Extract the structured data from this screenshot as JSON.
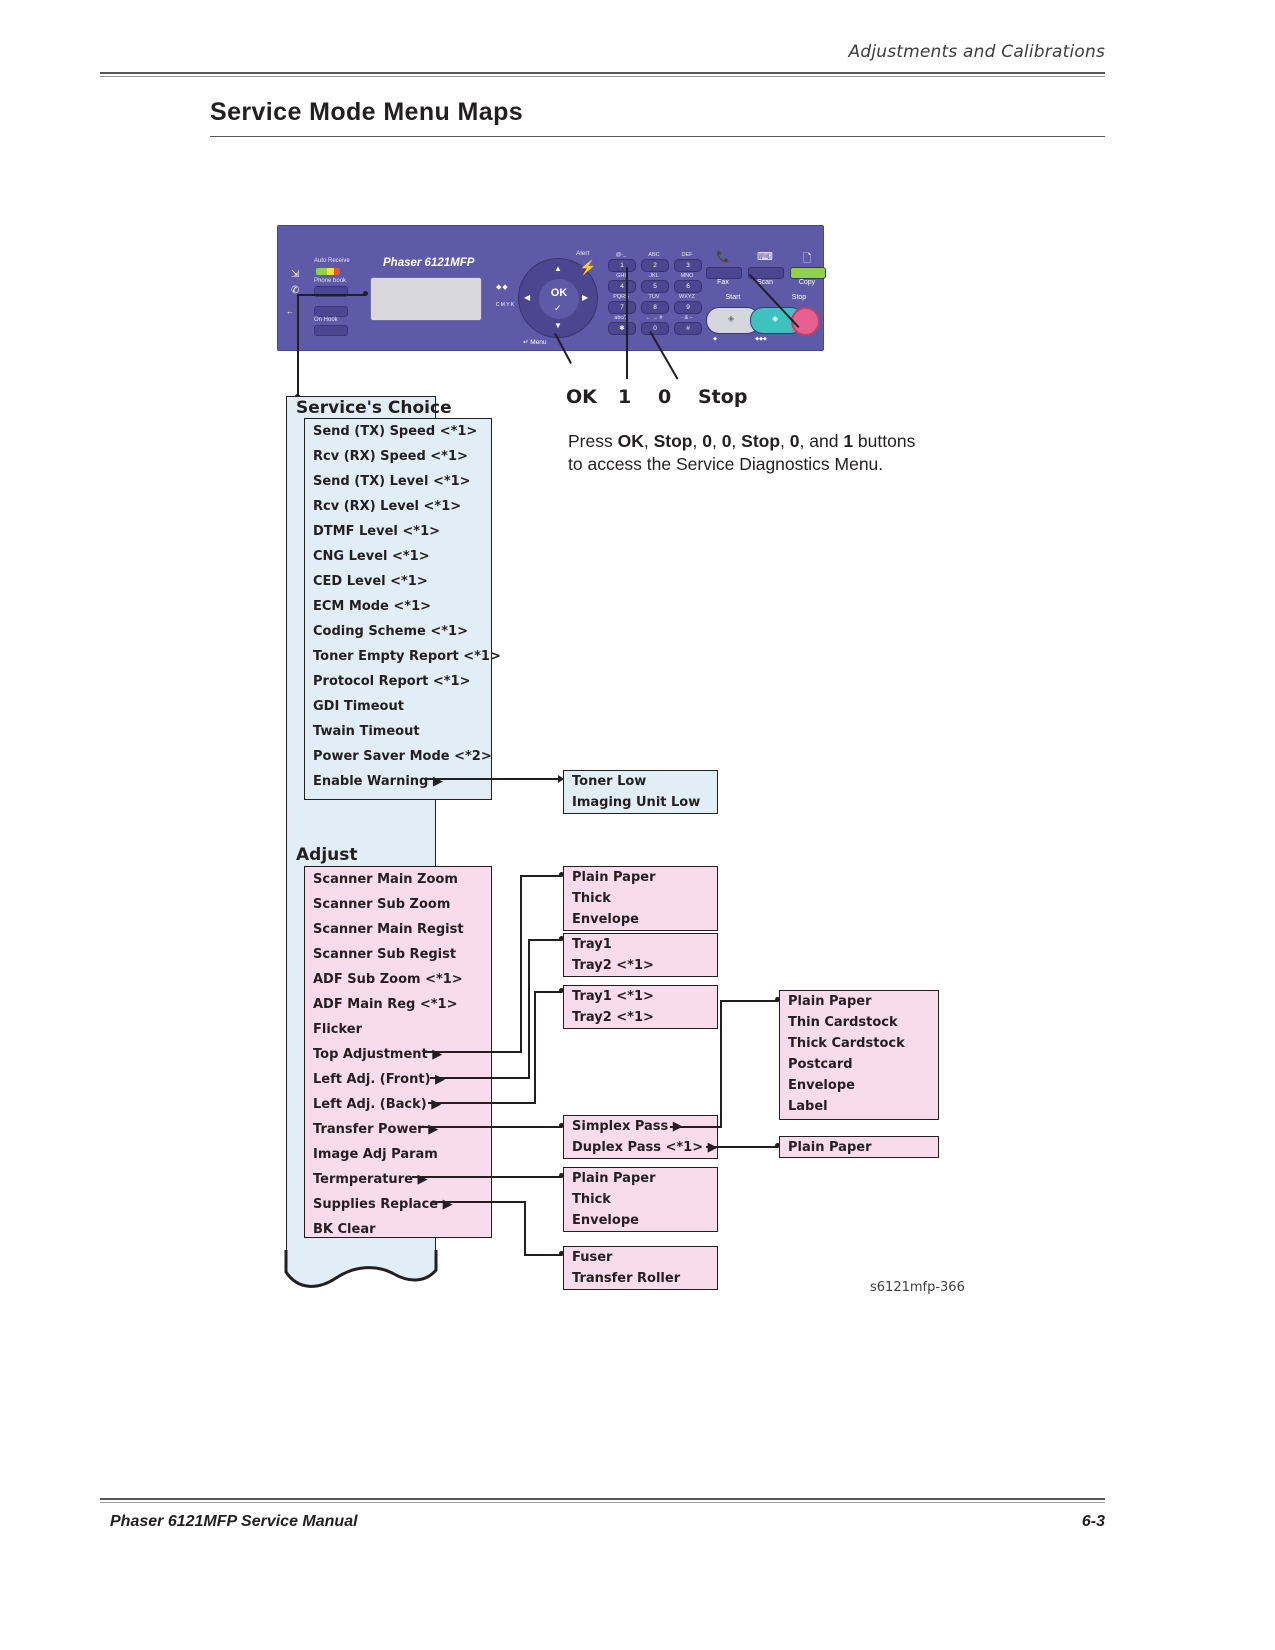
{
  "page": {
    "running_head": "Adjustments and Calibrations",
    "title": "Service Mode Menu Maps",
    "footer_left": "Phaser 6121MFP Service Manual",
    "footer_right": "6-3",
    "figure_caption": "s6121mfp-366"
  },
  "control_panel": {
    "model_name": "Phaser 6121MFP",
    "labels": {
      "auto_receive": "Auto Receive",
      "phone_book": "Phone book",
      "on_hook": "On Hook",
      "alert": "Alert",
      "start": "Start",
      "stop": "Stop",
      "menu": "Menu",
      "ok": "OK",
      "cmyk": "C M Y K"
    },
    "function_buttons": [
      {
        "label": "Fax",
        "icon": "fax-icon"
      },
      {
        "label": "Scan",
        "icon": "scanner-icon"
      },
      {
        "label": "Copy",
        "icon": "copy-icon"
      }
    ],
    "keypad": [
      {
        "key": "1",
        "caption": "@-_"
      },
      {
        "key": "2",
        "caption": "ABC"
      },
      {
        "key": "3",
        "caption": "DEF"
      },
      {
        "key": "4",
        "caption": "GHI"
      },
      {
        "key": "5",
        "caption": "JKL"
      },
      {
        "key": "6",
        "caption": "MNO"
      },
      {
        "key": "7",
        "caption": "PQRS"
      },
      {
        "key": "8",
        "caption": "TUV"
      },
      {
        "key": "9",
        "caption": "WXYZ"
      },
      {
        "key": "✱",
        "caption": "abc/1"
      },
      {
        "key": "0",
        "caption": "← → #"
      },
      {
        "key": "#",
        "caption": "· & −"
      }
    ]
  },
  "callouts": {
    "button_labels": [
      "OK",
      "1",
      "0",
      "Stop"
    ],
    "instruction_prefix": "Press ",
    "instruction_sequence": [
      "OK",
      "Stop",
      "0",
      "0",
      "Stop",
      "0",
      "1"
    ],
    "instruction_line1_tail": " buttons",
    "instruction_line2": "to access the Service Diagnostics Menu."
  },
  "menu_map": {
    "services_choice": {
      "title": "Service's Choice",
      "items": [
        "Send (TX) Speed <*1>",
        "Rcv (RX) Speed <*1>",
        "Send (TX) Level <*1>",
        "Rcv (RX) Level <*1>",
        "DTMF Level <*1>",
        "CNG Level <*1>",
        "CED Level <*1>",
        "ECM Mode <*1>",
        "Coding Scheme <*1>",
        "Toner Empty Report <*1>",
        "Protocol Report <*1>",
        "GDI Timeout",
        "Twain Timeout",
        "Power Saver Mode <*2>",
        "Enable Warning ▶"
      ]
    },
    "enable_warning_sub": {
      "items": [
        "Toner Low",
        "Imaging Unit Low"
      ]
    },
    "adjust": {
      "title": "Adjust",
      "items": [
        "Scanner Main Zoom",
        "Scanner Sub Zoom",
        "Scanner Main Regist",
        "Scanner Sub Regist",
        "ADF Sub Zoom <*1>",
        "ADF Main Reg <*1>",
        "Flicker",
        "Top Adjustment ▶",
        "Left Adj. (Front) ▶",
        "Left Adj. (Back) ▶",
        "Transfer Power ▶",
        "Image Adj Param",
        "Termperature ▶",
        "Supplies Replace ▶",
        "BK Clear"
      ]
    },
    "top_adjustment_sub": {
      "items": [
        "Plain Paper",
        "Thick",
        "Envelope"
      ]
    },
    "left_adj_front_sub": {
      "items": [
        "Tray1",
        "Tray2 <*1>"
      ]
    },
    "left_adj_back_sub": {
      "items": [
        "Tray1 <*1>",
        "Tray2 <*1>"
      ]
    },
    "transfer_power_sub": {
      "items": [
        "Simplex Pass ▶",
        "Duplex Pass  <*1> ▶"
      ]
    },
    "simplex_pass_sub": {
      "items": [
        "Plain Paper",
        "Thin Cardstock",
        "Thick Cardstock",
        "Postcard",
        "Envelope",
        "Label"
      ]
    },
    "duplex_pass_sub": {
      "items": [
        "Plain Paper"
      ]
    },
    "temperature_sub": {
      "items": [
        "Plain Paper",
        "Thick",
        "Envelope"
      ]
    },
    "supplies_replace_sub": {
      "items": [
        "Fuser",
        "Transfer Roller"
      ]
    }
  },
  "colors": {
    "panel_body": "#5d5aa8",
    "blue_box": "#e2eef6",
    "pink_box": "#f9dcec",
    "outline": "#231f20",
    "stop_button": "#e8608f",
    "start_button": "#3fc2bd"
  }
}
